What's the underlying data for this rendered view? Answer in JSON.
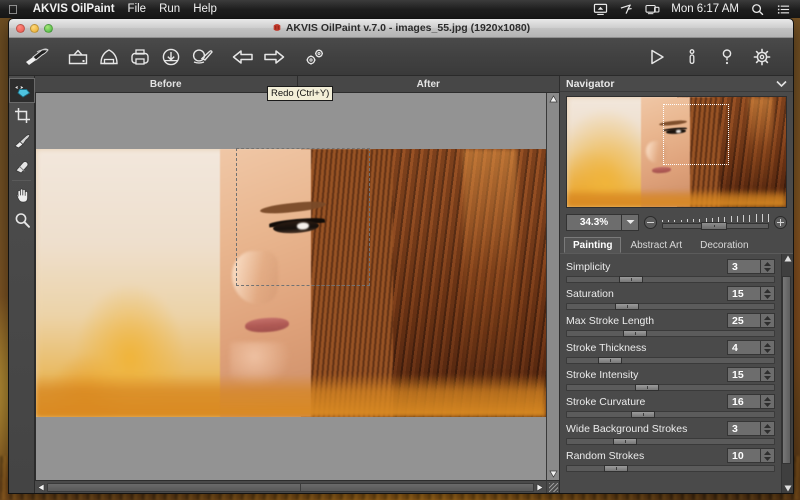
{
  "menubar": {
    "apple_icon": "apple-logo",
    "app_name": "AKVIS OilPaint",
    "items": [
      "File",
      "Run",
      "Help"
    ],
    "clock": "Mon 6:17 AM",
    "status_icons": [
      "airplay-icon",
      "bluetooth-share-icon",
      "screen-mirroring-icon",
      "spotlight-search-icon",
      "notification-center-icon"
    ]
  },
  "window": {
    "title": "AKVIS OilPaint v.7.0 - images_55.jpg (1920x1080)",
    "app_icon": "akvis-logo-icon",
    "controls": [
      "close",
      "minimize",
      "zoom"
    ]
  },
  "toolbar": {
    "buttons": [
      {
        "name": "akvis-brush-logo",
        "title": "AKVIS"
      },
      {
        "name": "open-image-icon",
        "title": "Open Image"
      },
      {
        "name": "save-image-icon",
        "title": "Save Image"
      },
      {
        "name": "print-image-icon",
        "title": "Print Image"
      },
      {
        "name": "batch-process-icon",
        "title": "Batch Processing"
      },
      {
        "name": "history-brush-icon",
        "title": "History Brush"
      },
      {
        "name": "undo-icon",
        "title": "Undo (Ctrl+Z)"
      },
      {
        "name": "redo-icon",
        "title": "Redo (Ctrl+Y)"
      },
      {
        "name": "presets-icon",
        "title": "Presets"
      }
    ],
    "right_buttons": [
      {
        "name": "run-icon",
        "title": "Run"
      },
      {
        "name": "info-icon",
        "title": "Info"
      },
      {
        "name": "help-icon",
        "title": "Help"
      },
      {
        "name": "preferences-gear-icon",
        "title": "Preferences"
      }
    ]
  },
  "tools": [
    {
      "name": "preview-eye-icon",
      "label": "Quick Preview",
      "selected": true
    },
    {
      "name": "crop-icon",
      "label": "Crop",
      "selected": false
    },
    {
      "name": "smudge-brush-icon",
      "label": "Smudge",
      "selected": false
    },
    {
      "name": "eraser-icon",
      "label": "Eraser",
      "selected": false
    },
    {
      "name": "hand-icon",
      "label": "Hand",
      "selected": false
    },
    {
      "name": "zoom-magnifier-icon",
      "label": "Zoom",
      "selected": false
    }
  ],
  "canvas": {
    "tabs": [
      {
        "label": "Before"
      },
      {
        "label": "After"
      }
    ],
    "tooltip": "Redo (Ctrl+Y)",
    "selection_visible": true
  },
  "navigator": {
    "title": "Navigator",
    "collapse_icon": "chevron-down-icon",
    "zoom_value": "34.3%",
    "zoom_dropdown_icon": "chevron-down-icon",
    "zoom_out_icon": "minus-circle-icon",
    "zoom_in_icon": "plus-circle-icon",
    "slider_percent": 36
  },
  "settings": {
    "tabs": [
      {
        "label": "Painting",
        "active": true
      },
      {
        "label": "Abstract Art",
        "active": false
      },
      {
        "label": "Decoration",
        "active": false
      }
    ],
    "parameters": [
      {
        "label": "Simplicity",
        "value": "3",
        "slider_percent": 25
      },
      {
        "label": "Saturation",
        "value": "15",
        "slider_percent": 23
      },
      {
        "label": "Max Stroke Length",
        "value": "25",
        "slider_percent": 27
      },
      {
        "label": "Stroke Thickness",
        "value": "4",
        "slider_percent": 15
      },
      {
        "label": "Stroke Intensity",
        "value": "15",
        "slider_percent": 33
      },
      {
        "label": "Stroke Curvature",
        "value": "16",
        "slider_percent": 31
      },
      {
        "label": "Wide Background Strokes",
        "value": "3",
        "slider_percent": 22
      },
      {
        "label": "Random Strokes",
        "value": "10",
        "slider_percent": 18
      }
    ]
  },
  "colors": {
    "panel_bg": "#4a4a4a",
    "toolbar_bg": "#414141",
    "canvas_bg": "#939393",
    "accent_text": "#ffffff",
    "tooltip_bg": "#f3efd8"
  }
}
